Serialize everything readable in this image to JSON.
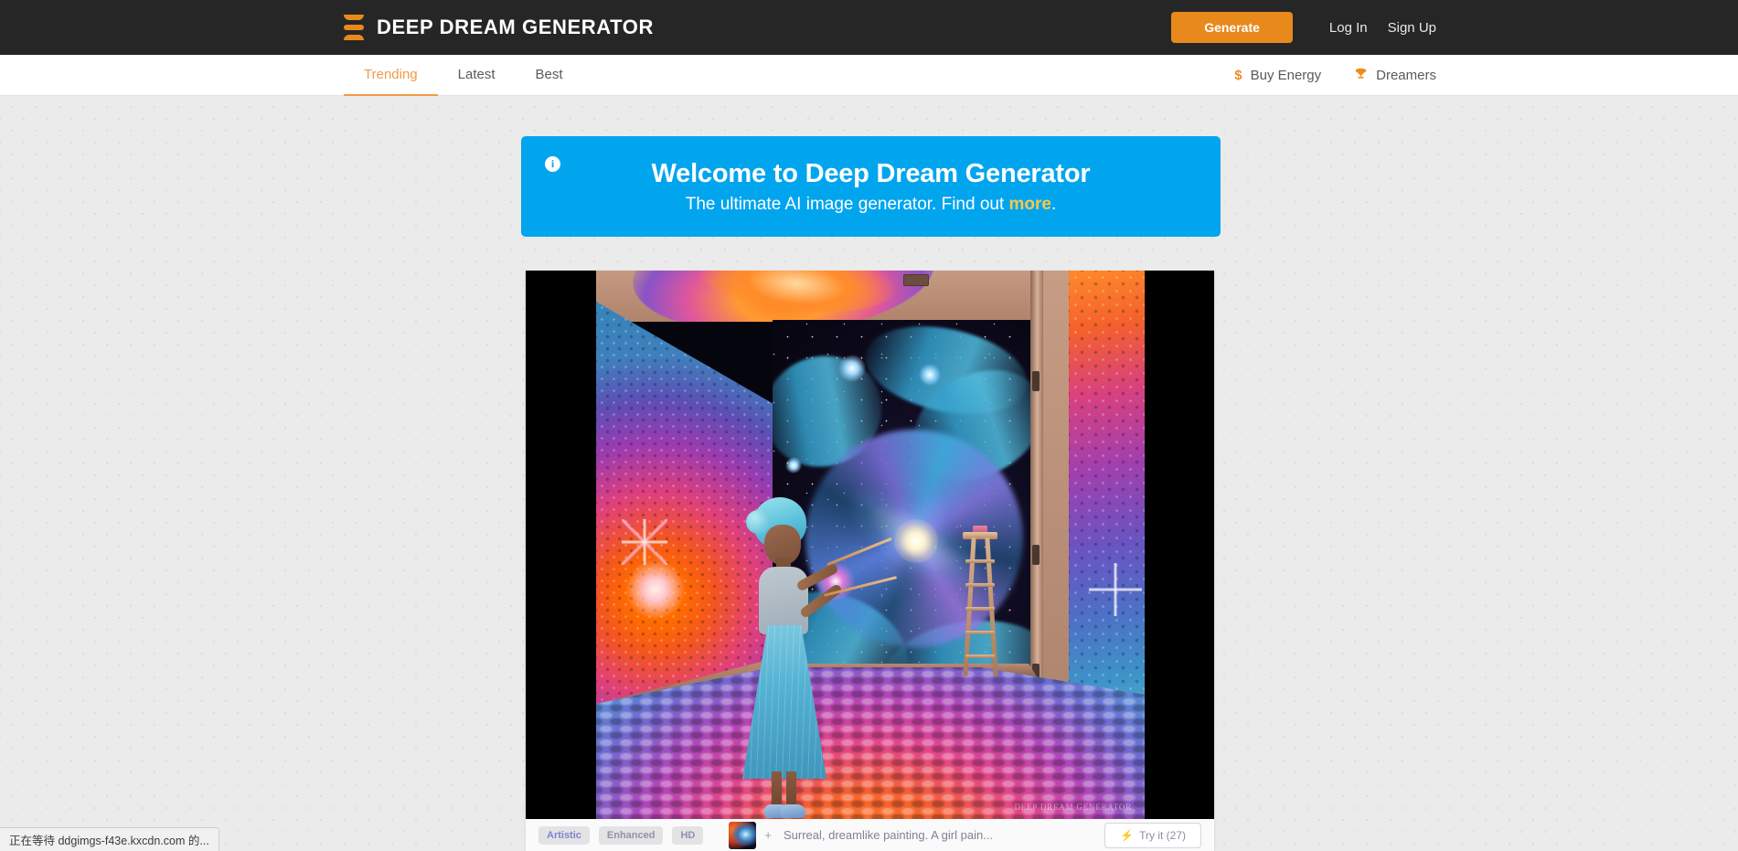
{
  "header": {
    "brand_name": "DEEP DREAM GENERATOR",
    "logo_icon": "stacked-bars-logo",
    "generate_label": "Generate",
    "login_label": "Log In",
    "signup_label": "Sign Up",
    "bg_color": "#262626",
    "accent_color": "#e8891c"
  },
  "subnav": {
    "tabs": [
      {
        "label": "Trending",
        "active": true
      },
      {
        "label": "Latest",
        "active": false
      },
      {
        "label": "Best",
        "active": false
      }
    ],
    "active_color": "#ef9b4b",
    "links": [
      {
        "label": "Buy Energy",
        "icon": "dollar-icon",
        "glyph": "$"
      },
      {
        "label": "Dreamers",
        "icon": "trophy-icon",
        "glyph": "♜"
      }
    ]
  },
  "banner": {
    "info_icon": "info-icon",
    "info_glyph": "i",
    "title": "Welcome to Deep Dream Generator",
    "subtitle_before": "The ultimate AI image generator. Find out ",
    "subtitle_link": "more",
    "subtitle_after": ".",
    "bg_color": "#00a5ee",
    "link_color": "#ffc64c"
  },
  "artwork": {
    "alt": "Surreal painting of a girl painting a galaxy mural in a room filled with colorful spheres",
    "watermark": "DEEP DREAM GENERATOR"
  },
  "card_footer": {
    "tags": [
      "Artistic",
      "Enhanced",
      "HD"
    ],
    "prompt_plus": "+",
    "prompt_text": "Surreal, dreamlike painting. A girl pain...",
    "try_it_label": "Try it (27)",
    "try_it_icon": "bolt-icon",
    "bolt_glyph": "⚡"
  },
  "statusbar": {
    "text": "正在等待 ddgimgs-f43e.kxcdn.com 的..."
  }
}
